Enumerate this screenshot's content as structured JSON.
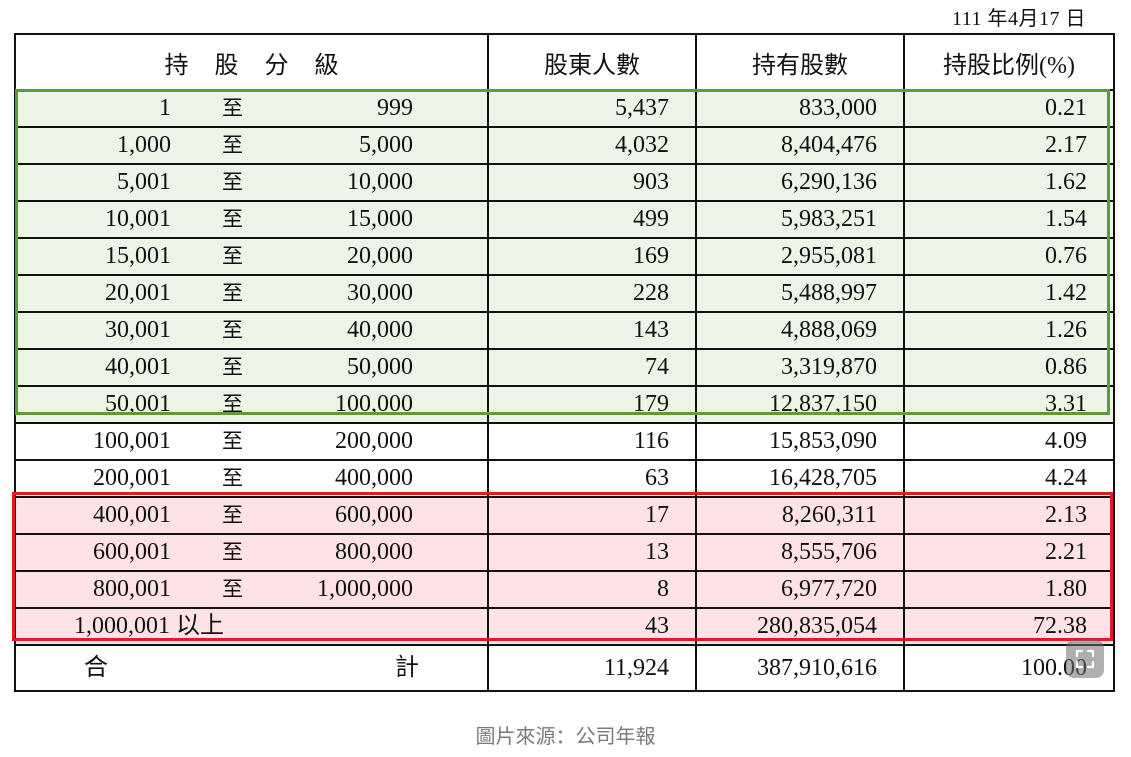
{
  "date": "111 年4月17 日",
  "header": {
    "range": "持股分級",
    "holders": "股東人數",
    "shares": "持有股數",
    "ratio": "持股比例(%)"
  },
  "rows": [
    {
      "from": "1",
      "to": "至",
      "end": "999",
      "holders": "5,437",
      "shares": "833,000",
      "ratio": "0.21",
      "group": "green"
    },
    {
      "from": "1,000",
      "to": "至",
      "end": "5,000",
      "holders": "4,032",
      "shares": "8,404,476",
      "ratio": "2.17",
      "group": "green"
    },
    {
      "from": "5,001",
      "to": "至",
      "end": "10,000",
      "holders": "903",
      "shares": "6,290,136",
      "ratio": "1.62",
      "group": "green"
    },
    {
      "from": "10,001",
      "to": "至",
      "end": "15,000",
      "holders": "499",
      "shares": "5,983,251",
      "ratio": "1.54",
      "group": "green"
    },
    {
      "from": "15,001",
      "to": "至",
      "end": "20,000",
      "holders": "169",
      "shares": "2,955,081",
      "ratio": "0.76",
      "group": "green"
    },
    {
      "from": "20,001",
      "to": "至",
      "end": "30,000",
      "holders": "228",
      "shares": "5,488,997",
      "ratio": "1.42",
      "group": "green"
    },
    {
      "from": "30,001",
      "to": "至",
      "end": "40,000",
      "holders": "143",
      "shares": "4,888,069",
      "ratio": "1.26",
      "group": "green"
    },
    {
      "from": "40,001",
      "to": "至",
      "end": "50,000",
      "holders": "74",
      "shares": "3,319,870",
      "ratio": "0.86",
      "group": "green"
    },
    {
      "from": "50,001",
      "to": "至",
      "end": "100,000",
      "holders": "179",
      "shares": "12,837,150",
      "ratio": "3.31",
      "group": "green"
    },
    {
      "from": "100,001",
      "to": "至",
      "end": "200,000",
      "holders": "116",
      "shares": "15,853,090",
      "ratio": "4.09",
      "group": "none"
    },
    {
      "from": "200,001",
      "to": "至",
      "end": "400,000",
      "holders": "63",
      "shares": "16,428,705",
      "ratio": "4.24",
      "group": "none"
    },
    {
      "from": "400,001",
      "to": "至",
      "end": "600,000",
      "holders": "17",
      "shares": "8,260,311",
      "ratio": "2.13",
      "group": "red"
    },
    {
      "from": "600,001",
      "to": "至",
      "end": "800,000",
      "holders": "13",
      "shares": "8,555,706",
      "ratio": "2.21",
      "group": "red"
    },
    {
      "from": "800,001",
      "to": "至",
      "end": "1,000,000",
      "holders": "8",
      "shares": "6,977,720",
      "ratio": "1.80",
      "group": "red"
    },
    {
      "from": "1,000,001 以上",
      "to": "",
      "end": "",
      "holders": "43",
      "shares": "280,835,054",
      "ratio": "72.38",
      "group": "red"
    }
  ],
  "total": {
    "left": "合",
    "right": "計",
    "holders": "11,924",
    "shares": "387,910,616",
    "ratio": "100.00"
  },
  "colors": {
    "green_highlight": "#5d9b39",
    "red_highlight": "#e01b24"
  },
  "expand_button_icon": "expand-icon",
  "caption": "圖片來源：公司年報"
}
